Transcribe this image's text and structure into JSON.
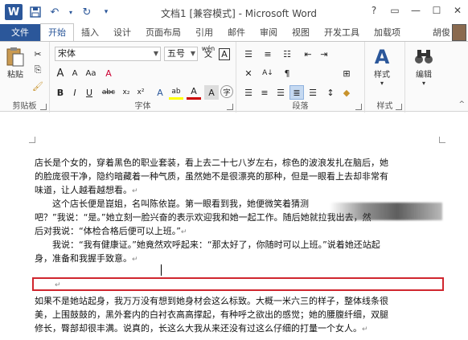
{
  "titlebar": {
    "app_logo": "W",
    "title": "文档1 [兼容模式] - Microsoft Word",
    "controls": [
      "?",
      "▭",
      "—",
      "☐",
      "✕"
    ]
  },
  "tabs": [
    "文件",
    "开始",
    "插入",
    "设计",
    "页面布局",
    "引用",
    "邮件",
    "审阅",
    "视图",
    "开发工具",
    "加载项"
  ],
  "active_tab": "开始",
  "user": "胡俊",
  "ribbon": {
    "clipboard": {
      "paste": "粘贴",
      "label": "剪贴板"
    },
    "font": {
      "name": "宋体",
      "size": "五号",
      "wen": "wén",
      "wen_char": "文",
      "grow": "A",
      "shrink": "A",
      "aa": "Aa",
      "clear": "A",
      "bold": "B",
      "italic": "I",
      "underline": "U",
      "strike": "abc",
      "sub": "x₂",
      "sup": "x²",
      "highlight": "ab",
      "color": "A",
      "charborder": "A",
      "label": "字体"
    },
    "paragraph": {
      "label": "段落",
      "sort": "A↓",
      "pilcrow": "¶"
    },
    "styles": {
      "label": "样式",
      "icon": "A"
    },
    "editing": {
      "label": "编辑"
    }
  },
  "document": {
    "lines": [
      "店长是个女的，穿着黑色的职业套装，看上去二十七八岁左右，棕色的波浪发扎在脑后，她",
      "的脸庞很干净，隐约暗藏着一种气质，虽然她不是很漂亮的那种，但是一眼看上去却非常有",
      "味道，让人越看越想看。",
      "　　这个店长便是崑姐，名叫陈依崑。第一眼看到我，她便微笑着猜测",
      "吧？”我说：“是。”她立刻一脸兴奋的表示欢迎我和她一起工作。随后她就拉我出去，然",
      "后对我说：“体检合格后便可以上班。”",
      "　　我说：“我有健康证。”她竟然欢呼起来：“那太好了，你随时可以上班。”说着她还站起",
      "身，准备和我握手致意。",
      "如果不是她站起身，我万万没有想到她身材会这么标致。大概一米六三的样子，整体线条很",
      "美，上围鼓鼓的，黑外套内的白衬衣高高撑起，有种呼之欲出的感觉；她的腰腹纤细，双腿",
      "修长，臀部却很丰满。说真的，长这么大我从来还没有过这么仔细的打量一个女人。"
    ],
    "para_mark": "↵"
  }
}
